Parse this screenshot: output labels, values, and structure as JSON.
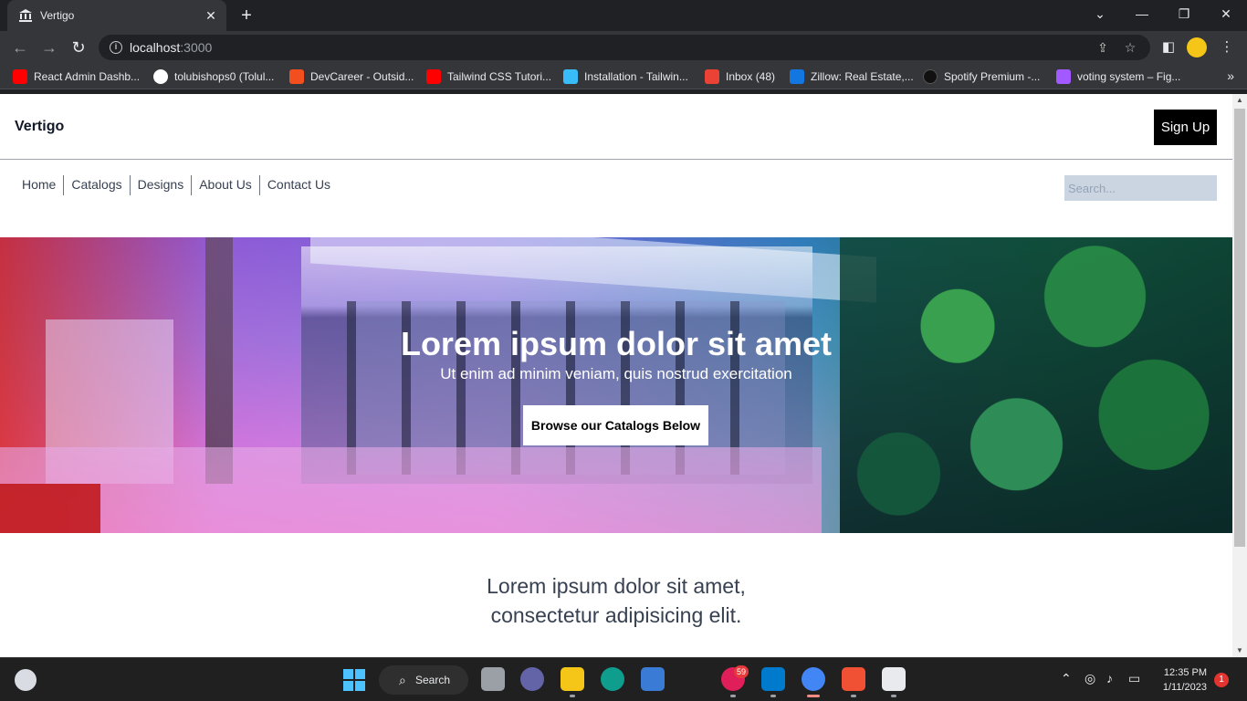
{
  "browser": {
    "tab_title": "Vertigo",
    "tab_close": "✕",
    "new_tab": "+",
    "url_host": "localhost",
    "url_port": ":3000",
    "window_controls": [
      "⌄",
      "—",
      "❐",
      "✕"
    ]
  },
  "bookmarks": [
    {
      "label": "React Admin Dashb...",
      "icon": "youtube-icon",
      "color": "#ff0000"
    },
    {
      "label": "tolubishops0 (Tolul...",
      "icon": "github-icon",
      "color": "#ffffff"
    },
    {
      "label": "DevCareer - Outsid...",
      "icon": "figma-icon",
      "color": "#f24e1e"
    },
    {
      "label": "Tailwind CSS Tutori...",
      "icon": "youtube-icon",
      "color": "#ff0000"
    },
    {
      "label": "Installation - Tailwin...",
      "icon": "tailwind-icon",
      "color": "#38bdf8"
    },
    {
      "label": "Inbox (48)",
      "icon": "gmail-icon",
      "color": "#ea4335"
    },
    {
      "label": "Zillow: Real Estate,...",
      "icon": "zillow-icon",
      "color": "#1277e1"
    },
    {
      "label": "Spotify Premium -...",
      "icon": "spotify-icon",
      "color": "#111111"
    },
    {
      "label": "voting system – Fig...",
      "icon": "figma-icon",
      "color": "#a259ff"
    }
  ],
  "bookmarks_more": "»",
  "site": {
    "logo": "Vertigo",
    "signup_label": "Sign Up",
    "nav": [
      "Home",
      "Catalogs",
      "Designs",
      "About Us",
      "Contact Us"
    ],
    "search_placeholder": "Search...",
    "hero_title": "Lorem ipsum dolor sit amet",
    "hero_subtitle": "Ut enim ad minim veniam, quis nostrud exercitation",
    "hero_button": "Browse our Catalogs Below",
    "intro_line1": "Lorem ipsum dolor sit amet,",
    "intro_line2": "consectetur adipisicing elit."
  },
  "taskbar": {
    "search_label": "Search",
    "slack_badge": "59",
    "time": "12:35 PM",
    "date": "1/11/2023",
    "notifications": "1"
  },
  "colors": {
    "accent": "#000000",
    "search_bg": "#cbd5e1",
    "chrome_bg": "#202124"
  }
}
